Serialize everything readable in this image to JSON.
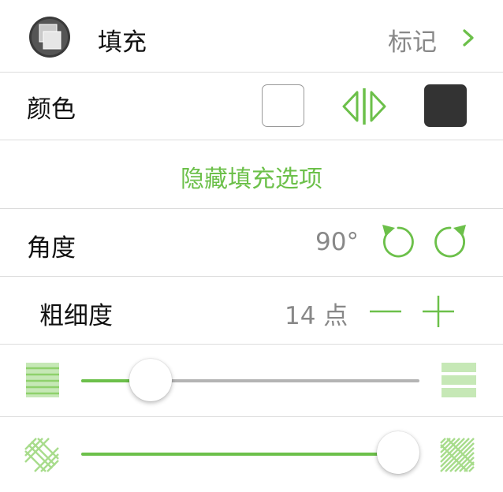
{
  "header": {
    "title": "填充",
    "link_label": "标记",
    "icon": "fill-style-icon",
    "chevron": "chevron-right-icon"
  },
  "color": {
    "label": "颜色",
    "left_swatch": "#ffffff",
    "right_swatch": "#333333",
    "swap_icon": "swap-colors-icon"
  },
  "hide_options": {
    "label": "隐藏填充选项"
  },
  "angle": {
    "label": "角度",
    "value": "90°",
    "rotate_ccw_icon": "rotate-ccw-icon",
    "rotate_cw_icon": "rotate-cw-icon"
  },
  "thickness": {
    "label": "粗细度",
    "value": "14 点",
    "decrease_icon": "minus-icon",
    "increase_icon": "plus-icon"
  },
  "spacing_slider": {
    "level": 0.18,
    "min_icon": "dense-lines-icon",
    "max_icon": "sparse-lines-icon"
  },
  "pattern_slider": {
    "level": 0.95,
    "min_icon": "weave-pattern-icon",
    "max_icon": "diagonal-pattern-icon"
  },
  "colors": {
    "accent": "#6cc04a",
    "track": "#b4b4b4",
    "divider": "#dcdcdc"
  }
}
